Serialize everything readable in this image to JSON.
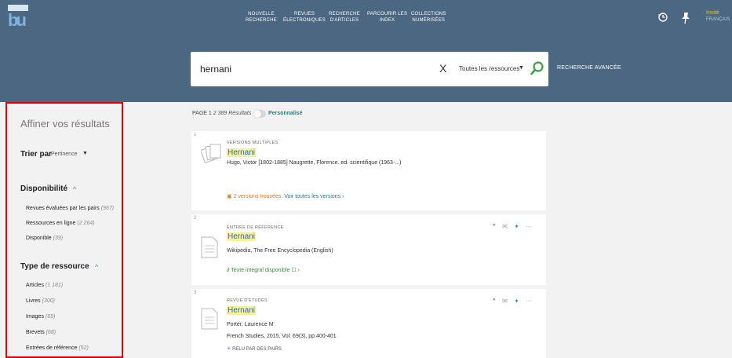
{
  "header": {
    "logo_text": "bu",
    "nav": [
      {
        "line1": "NOUVELLE",
        "line2": "RECHERCHE"
      },
      {
        "line1": "REVUES",
        "line2": "ÉLECTRONIQUES"
      },
      {
        "line1": "RECHERCHE",
        "line2": "D'ARTICLES"
      },
      {
        "line1": "PARCOURIR LES",
        "line2": "INDEX"
      },
      {
        "line1": "COLLECTIONS",
        "line2": "NUMÉRISÉES"
      }
    ],
    "history_icon": "history-icon",
    "pin_icon": "pin-icon",
    "guest_name": "Invité",
    "guest_lang": "FRANÇAIS"
  },
  "search": {
    "query": "hernani",
    "clear": "X",
    "scope": "Toutes les ressources",
    "scope_arrow": "▼",
    "advanced": "RECHERCHE AVANCÉE"
  },
  "sidebar": {
    "title": "Affiner vos résultats",
    "sort_label": "Trier par",
    "sort_value": "Pertinence",
    "sort_arrow": "▼",
    "availability": {
      "heading": "Disponibilité",
      "chevron": "^",
      "items": [
        {
          "label": "Revues évaluées par les pairs",
          "count": "(967)"
        },
        {
          "label": "Ressources en ligne",
          "count": "(2 264)"
        },
        {
          "label": "Disponible",
          "count": "(39)"
        }
      ]
    },
    "resource_type": {
      "heading": "Type de ressource",
      "chevron": "^",
      "items": [
        {
          "label": "Articles",
          "count": "(1 181)"
        },
        {
          "label": "Livres",
          "count": "(300)"
        },
        {
          "label": "Images",
          "count": "(69)"
        },
        {
          "label": "Brevets",
          "count": "(68)"
        },
        {
          "label": "Entrées de référence",
          "count": "(52)"
        }
      ]
    }
  },
  "results": {
    "page_label": "PAGE 1",
    "count": "2 389 Résultats",
    "personalized": "Personnalisé",
    "actions": {
      "quote": "❞",
      "email": "✉",
      "pin": "✦",
      "more": "···"
    },
    "items": [
      {
        "num": "1",
        "type": "VERSIONS MULTIPLES",
        "title": "Hernani",
        "meta1": "Hugo, Victor [1802-1885] Naugrette, Florence. ed. scientifique (1963-...)",
        "meta2": "",
        "versions": "2 versions trouvées.",
        "versions_link": "Voir toutes les versions ›"
      },
      {
        "num": "2",
        "type": "ENTRÉE DE RÉFÉRENCE",
        "title": "Hernani",
        "meta1": "Wikipedia, The Free Encyclopedia (English)",
        "fulltext": "Texte intégral disponible ☐ ›"
      },
      {
        "num": "3",
        "type": "REVUE D'ÉTUDES",
        "title": "Hernani",
        "meta1": "Porter, Laurence M",
        "meta2": "French Studies, 2015, Vol. 69(3), pp.400-401",
        "peer": "RELU PAR DES PAIRS"
      }
    ]
  }
}
